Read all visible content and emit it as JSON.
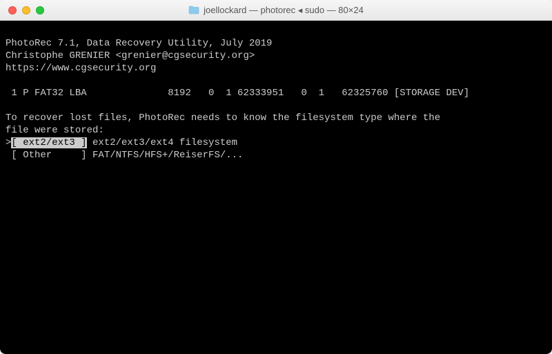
{
  "titlebar": {
    "title": "joellockard — photorec ◂ sudo — 80×24"
  },
  "terminal": {
    "header1": "PhotoRec 7.1, Data Recovery Utility, July 2019",
    "header2": "Christophe GRENIER <grenier@cgsecurity.org>",
    "header3": "https://www.cgsecurity.org",
    "partition_line": " 1 P FAT32 LBA              8192   0  1 62333951   0  1   62325760 [STORAGE DEV]",
    "prompt_line1": "To recover lost files, PhotoRec needs to know the filesystem type where the",
    "prompt_line2": "file were stored:",
    "option1_cursor": ">",
    "option1_label": "[ ext2/ext3 ]",
    "option1_desc": " ext2/ext3/ext4 filesystem",
    "option2_line": " [ Other     ] FAT/NTFS/HFS+/ReiserFS/..."
  }
}
